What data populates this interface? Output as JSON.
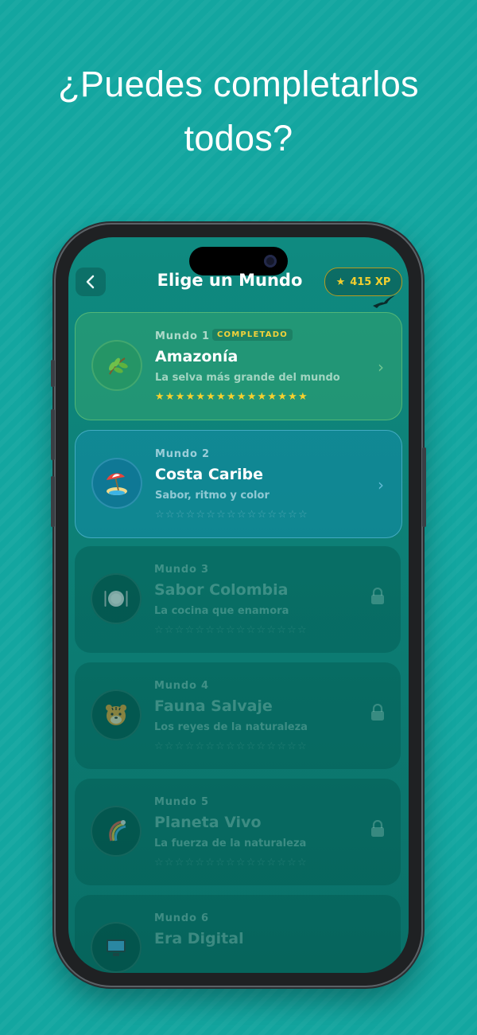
{
  "headline": {
    "line1": "¿Puedes completarlos",
    "line2": "todos?"
  },
  "header": {
    "title": "Elige un Mundo",
    "xp": "415 XP"
  },
  "worlds": [
    {
      "label": "Mundo 1",
      "badge": "COMPLETADO",
      "name": "Amazonía",
      "desc": "La selva más grande del mundo",
      "stars": "★★★★★★★★★★★★★★★",
      "state": "completed",
      "icon": "leaf-icon"
    },
    {
      "label": "Mundo 2",
      "name": "Costa Caribe",
      "desc": "Sabor, ritmo y color",
      "stars": "☆☆☆☆☆☆☆☆☆☆☆☆☆☆☆",
      "state": "available",
      "icon": "beach-umbrella-icon"
    },
    {
      "label": "Mundo 3",
      "name": "Sabor Colombia",
      "desc": "La cocina que enamora",
      "stars": "☆☆☆☆☆☆☆☆☆☆☆☆☆☆☆",
      "state": "locked",
      "icon": "plate-cutlery-icon"
    },
    {
      "label": "Mundo 4",
      "name": "Fauna Salvaje",
      "desc": "Los reyes de la naturaleza",
      "stars": "☆☆☆☆☆☆☆☆☆☆☆☆☆☆☆",
      "state": "locked",
      "icon": "tiger-face-icon"
    },
    {
      "label": "Mundo 5",
      "name": "Planeta Vivo",
      "desc": "La fuerza de la naturaleza",
      "stars": "☆☆☆☆☆☆☆☆☆☆☆☆☆☆☆",
      "state": "locked",
      "icon": "rainbow-icon"
    },
    {
      "label": "Mundo 6",
      "name": "Era Digital",
      "state": "locked",
      "icon": "computer-icon"
    }
  ],
  "colors": {
    "background": "#13a6a0",
    "gold": "#f3cf2e",
    "completed": "#3caa6e",
    "available": "#148caa"
  }
}
